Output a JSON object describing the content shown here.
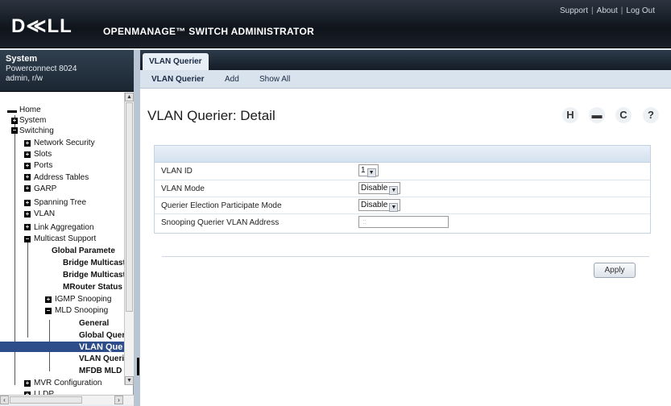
{
  "header": {
    "logo": "D≪LL",
    "product": "OPENMANAGE™ SWITCH ADMINISTRATOR",
    "links": [
      "Support",
      "About",
      "Log Out"
    ]
  },
  "system": {
    "title": "System",
    "model": "Powerconnect 8024",
    "user": "admin, r/w"
  },
  "tree": [
    {
      "label": "Home"
    },
    {
      "label": "System"
    },
    {
      "label": "Switching"
    },
    {
      "label": "Network Security"
    },
    {
      "label": "Slots"
    },
    {
      "label": "Ports"
    },
    {
      "label": "Address Tables"
    },
    {
      "label": "GARP"
    },
    {
      "label": "Spanning Tree"
    },
    {
      "label": "VLAN"
    },
    {
      "label": "Link Aggregation"
    },
    {
      "label": "Multicast Support"
    },
    {
      "label": "Global Paramete"
    },
    {
      "label": "Bridge Multicast"
    },
    {
      "label": "Bridge Multicast"
    },
    {
      "label": "MRouter Status"
    },
    {
      "label": "IGMP Snooping"
    },
    {
      "label": "MLD Snooping"
    },
    {
      "label": "General"
    },
    {
      "label": "Global Quer"
    },
    {
      "label": "VLAN Que"
    },
    {
      "label": "VLAN Queri"
    },
    {
      "label": "MFDB MLD"
    },
    {
      "label": "MVR Configuration"
    },
    {
      "label": "LLDP"
    }
  ],
  "tabs": {
    "main": "VLAN Querier",
    "sub": [
      "VLAN Querier",
      "Add",
      "Show All"
    ]
  },
  "page": {
    "title": "VLAN Querier: Detail"
  },
  "form": {
    "rows": [
      {
        "label": "VLAN ID",
        "value": "1"
      },
      {
        "label": "VLAN Mode",
        "value": "Disable"
      },
      {
        "label": "Querier Election Participate Mode",
        "value": "Disable"
      },
      {
        "label": "Snooping Querier VLAN Address",
        "value": "::"
      }
    ],
    "apply": "Apply"
  }
}
